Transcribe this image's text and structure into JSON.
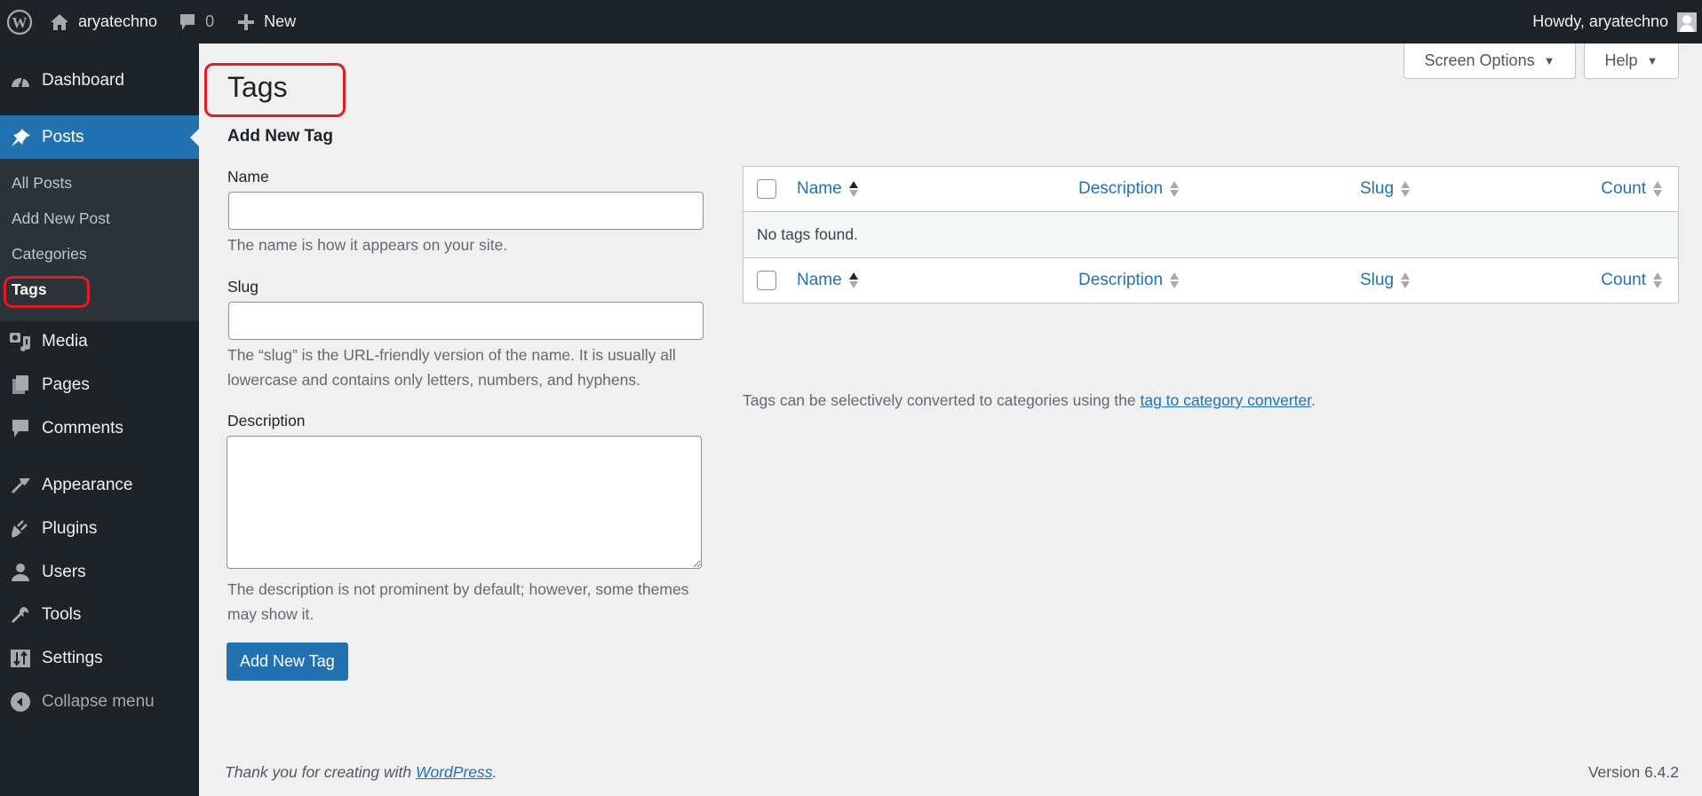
{
  "adminbar": {
    "site_name": "aryatechno",
    "comments_count": "0",
    "new_label": "New",
    "howdy": "Howdy, aryatechno"
  },
  "sidebar": {
    "items": [
      {
        "label": "Dashboard",
        "icon": "dashboard-icon"
      },
      {
        "label": "Posts",
        "icon": "pin-icon",
        "active": true
      },
      {
        "label": "Media",
        "icon": "media-icon"
      },
      {
        "label": "Pages",
        "icon": "pages-icon"
      },
      {
        "label": "Comments",
        "icon": "comment-icon"
      },
      {
        "label": "Appearance",
        "icon": "brush-icon"
      },
      {
        "label": "Plugins",
        "icon": "plug-icon"
      },
      {
        "label": "Users",
        "icon": "user-icon"
      },
      {
        "label": "Tools",
        "icon": "wrench-icon"
      },
      {
        "label": "Settings",
        "icon": "settings-icon"
      }
    ],
    "submenu": [
      "All Posts",
      "Add New Post",
      "Categories",
      "Tags"
    ],
    "collapse_label": "Collapse menu"
  },
  "header": {
    "title": "Tags",
    "screen_options": "Screen Options",
    "help": "Help"
  },
  "form": {
    "title": "Add New Tag",
    "name_label": "Name",
    "name_value": "",
    "name_help": "The name is how it appears on your site.",
    "slug_label": "Slug",
    "slug_value": "",
    "slug_help": "The “slug” is the URL-friendly version of the name. It is usually all lowercase and contains only letters, numbers, and hyphens.",
    "description_label": "Description",
    "description_value": "",
    "description_help": "The description is not prominent by default; however, some themes may show it.",
    "submit_label": "Add New Tag"
  },
  "table": {
    "columns": [
      "Name",
      "Description",
      "Slug",
      "Count"
    ],
    "empty_message": "No tags found."
  },
  "convert_note": {
    "text": "Tags can be selectively converted to categories using the ",
    "link": "tag to category converter",
    "suffix": "."
  },
  "footer": {
    "thanks_text": "Thank you for creating with ",
    "thanks_link": "WordPress",
    "thanks_suffix": ".",
    "version": "Version 6.4.2"
  },
  "colors": {
    "accent": "#2271b1",
    "adminbar_bg": "#1d2327",
    "annotation": "#e21b25"
  }
}
